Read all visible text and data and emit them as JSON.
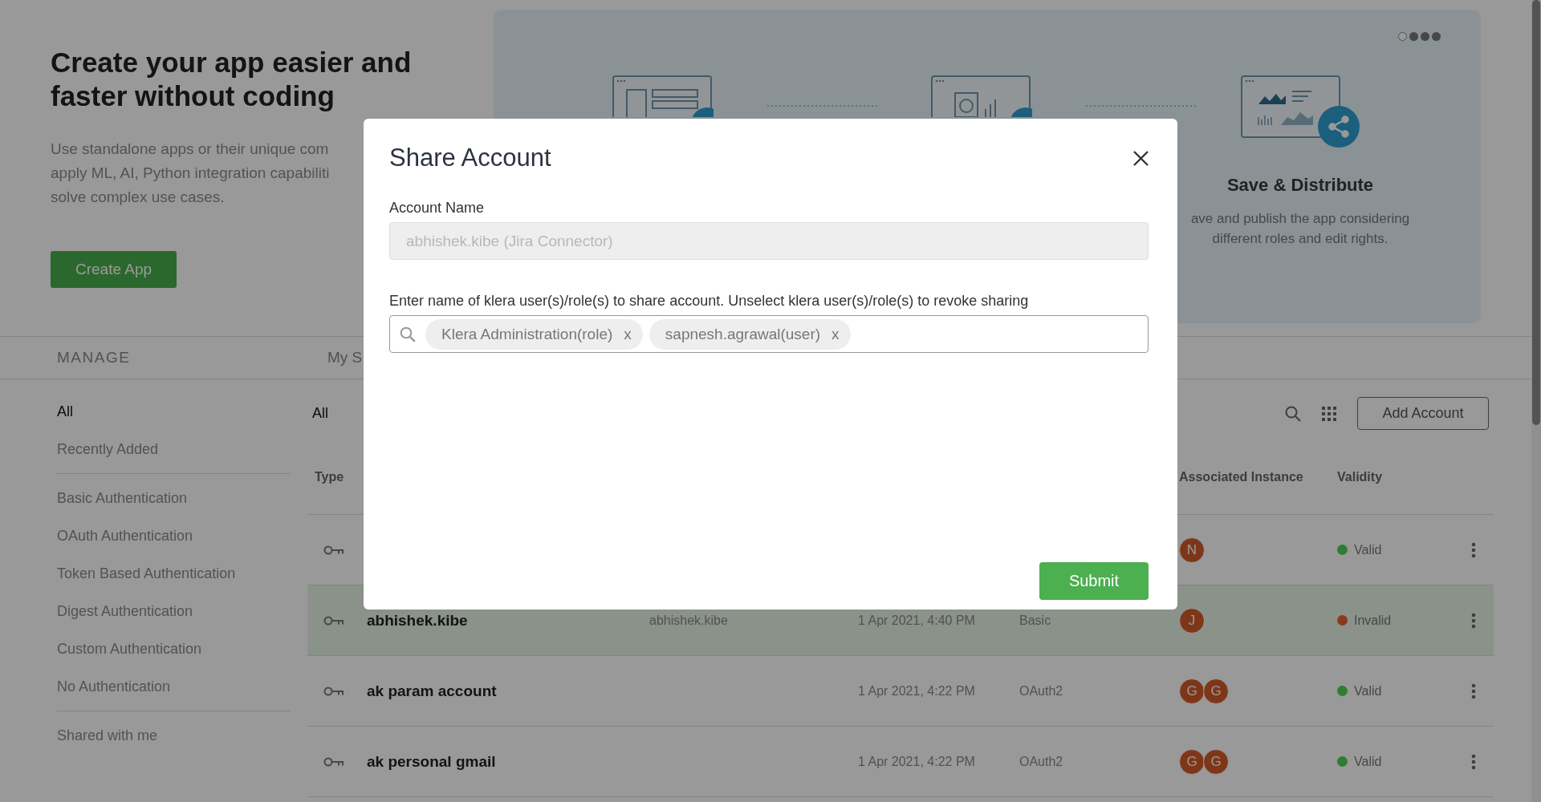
{
  "hero": {
    "title": "Create your app easier and faster without coding",
    "description_lines": [
      "Use standalone apps or their unique com",
      "apply ML, AI, Python integration capabiliti",
      "solve complex use cases."
    ],
    "button": "Create App"
  },
  "banner": {
    "dots": [
      {
        "selected": true
      },
      {
        "selected": false
      },
      {
        "selected": false
      },
      {
        "selected": false
      }
    ],
    "steps": [
      {
        "kind": "layout"
      },
      {
        "kind": "chart"
      },
      {
        "kind": "share",
        "title": "Save & Distribute",
        "description_lines": [
          "ave and publish the app considering",
          "different roles and edit rights."
        ]
      }
    ]
  },
  "manage_bar": {
    "title": "MANAGE",
    "next_tab": "My S"
  },
  "nav": {
    "sections": [
      {
        "items": [
          {
            "label": "All",
            "selected": true
          },
          {
            "label": "Recently Added",
            "selected": false
          }
        ]
      },
      {
        "items": [
          {
            "label": "Basic Authentication",
            "selected": false
          },
          {
            "label": "OAuth Authentication",
            "selected": false
          },
          {
            "label": "Token Based Authentication",
            "selected": false
          },
          {
            "label": "Digest Authentication",
            "selected": false
          },
          {
            "label": "Custom Authentication",
            "selected": false
          },
          {
            "label": "No Authentication",
            "selected": false
          }
        ]
      },
      {
        "items": [
          {
            "label": "Shared with me",
            "selected": false
          }
        ]
      }
    ]
  },
  "toolbar": {
    "filter_label": "All",
    "add_button": "Add Account"
  },
  "table": {
    "columns": {
      "type": "Type",
      "associated_instance": "Associated Instance",
      "validity": "Validity"
    },
    "rows": [
      {
        "selected": false,
        "instances": [
          "N"
        ],
        "validity": {
          "label": "Valid",
          "color": "#2e7d32"
        }
      },
      {
        "selected": true,
        "name": "abhishek.kibe",
        "column_3": "abhishek.kibe",
        "date": "1 Apr 2021, 4:40 PM",
        "auth_type": "Basic",
        "instances": [
          "J"
        ],
        "validity": {
          "label": "Invalid",
          "color": "#8a3a1c"
        }
      },
      {
        "selected": false,
        "name": "ak param account",
        "date": "1 Apr 2021, 4:22 PM",
        "auth_type": "OAuth2",
        "instances": [
          "G",
          "G"
        ],
        "validity": {
          "label": "Valid",
          "color": "#2e7d32"
        }
      },
      {
        "selected": false,
        "name": "ak personal gmail",
        "date": "1 Apr 2021, 4:22 PM",
        "auth_type": "OAuth2",
        "instances": [
          "G",
          "G"
        ],
        "validity": {
          "label": "Valid",
          "color": "#2e7d32"
        }
      }
    ]
  },
  "modal": {
    "title": "Share Account",
    "account_label": "Account Name",
    "account_field": {
      "value": "abhishek.kibe (Jira Connector)",
      "disabled": true
    },
    "share_label": "Enter name of klera user(s)/role(s) to share account. Unselect klera user(s)/role(s) to revoke sharing",
    "tags": [
      {
        "label": "Klera Administration(role)",
        "remove": "x"
      },
      {
        "label": "sapnesh.agrawal(user)",
        "remove": "x"
      }
    ],
    "submit": "Submit"
  }
}
